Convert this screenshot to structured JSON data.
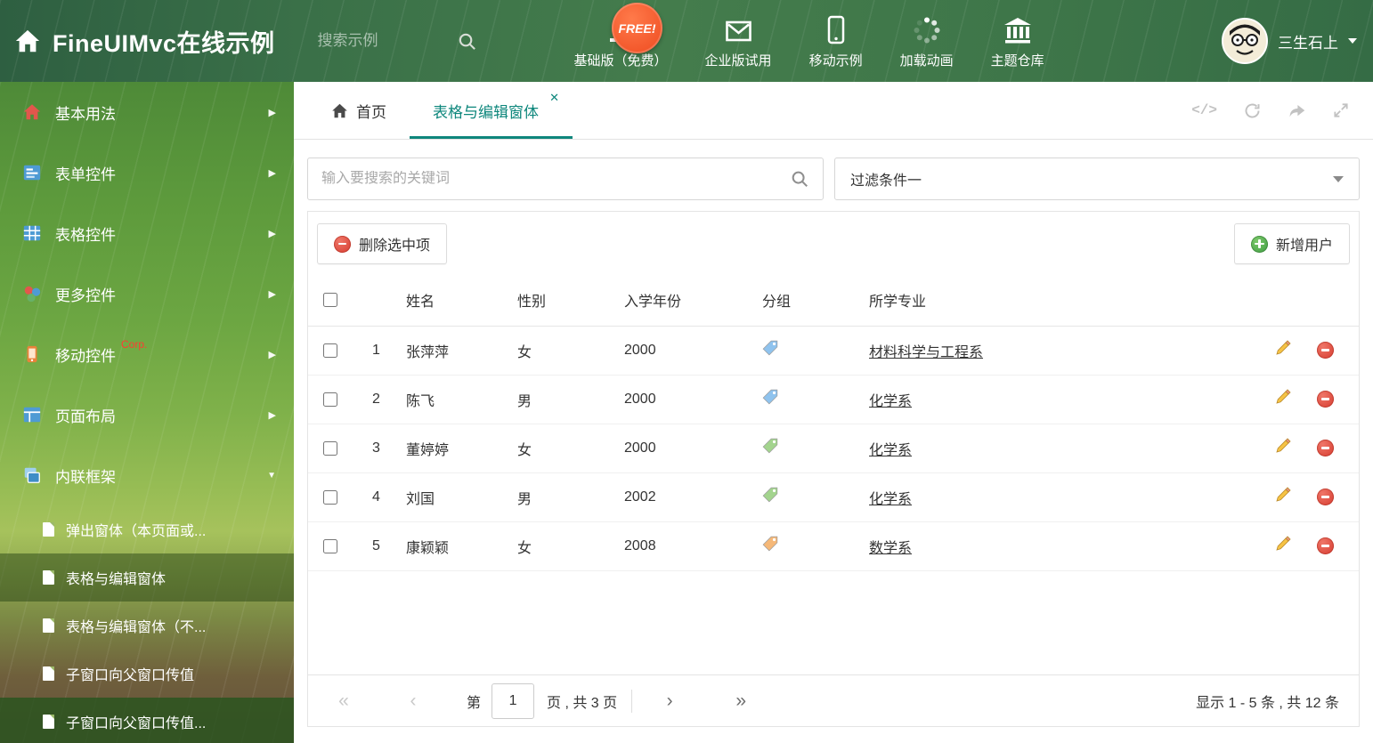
{
  "header": {
    "title": "FineUIMvc在线示例",
    "search_placeholder": "搜索示例",
    "free_badge": "FREE!",
    "nav": [
      {
        "label": "基础版（免费）",
        "icon": "download-icon"
      },
      {
        "label": "企业版试用",
        "icon": "mail-icon"
      },
      {
        "label": "移动示例",
        "icon": "mobile-icon"
      },
      {
        "label": "加载动画",
        "icon": "spinner-icon"
      },
      {
        "label": "主题仓库",
        "icon": "bank-icon"
      }
    ],
    "user_name": "三生石上"
  },
  "sidebar": {
    "items": [
      {
        "label": "基本用法",
        "icon": "home-icon"
      },
      {
        "label": "表单控件",
        "icon": "form-icon"
      },
      {
        "label": "表格控件",
        "icon": "table-icon"
      },
      {
        "label": "更多控件",
        "icon": "shapes-icon"
      },
      {
        "label": "移动控件",
        "icon": "mobile-icon",
        "badge": "Corp."
      },
      {
        "label": "页面布局",
        "icon": "layout-icon"
      },
      {
        "label": "内联框架",
        "icon": "frames-icon",
        "expanded": true
      }
    ],
    "subitems": [
      {
        "label": "弹出窗体（本页面或..."
      },
      {
        "label": "表格与编辑窗体",
        "selected": true
      },
      {
        "label": "表格与编辑窗体（不..."
      },
      {
        "label": "子窗口向父窗口传值"
      },
      {
        "label": "子窗口向父窗口传值..."
      }
    ]
  },
  "tabs": {
    "home": "首页",
    "active": "表格与编辑窗体"
  },
  "filters": {
    "search_placeholder": "输入要搜索的关键词",
    "selected_filter": "过滤条件一"
  },
  "toolbar": {
    "delete_label": "删除选中项",
    "add_label": "新增用户"
  },
  "table": {
    "columns": [
      "姓名",
      "性别",
      "入学年份",
      "分组",
      "所学专业"
    ],
    "rows": [
      {
        "num": "1",
        "name": "张萍萍",
        "gender": "女",
        "year": "2000",
        "tag_color": "#8fc3ee",
        "major": "材料科学与工程系"
      },
      {
        "num": "2",
        "name": "陈飞",
        "gender": "男",
        "year": "2000",
        "tag_color": "#8fc3ee",
        "major": "化学系"
      },
      {
        "num": "3",
        "name": "董婷婷",
        "gender": "女",
        "year": "2000",
        "tag_color": "#a3d48e",
        "major": "化学系"
      },
      {
        "num": "4",
        "name": "刘国",
        "gender": "男",
        "year": "2002",
        "tag_color": "#a3d48e",
        "major": "化学系"
      },
      {
        "num": "5",
        "name": "康颖颖",
        "gender": "女",
        "year": "2008",
        "tag_color": "#f5b878",
        "major": "数学系"
      }
    ]
  },
  "pagination": {
    "page_prefix": "第",
    "current_page": "1",
    "page_suffix": "页 , 共 3 页",
    "summary": "显示 1 - 5 条 , 共 12 条"
  },
  "colors": {
    "accent": "#0e877c",
    "danger": "#dc4c41",
    "success": "#3f9d43",
    "header_green": "#3a7048"
  }
}
